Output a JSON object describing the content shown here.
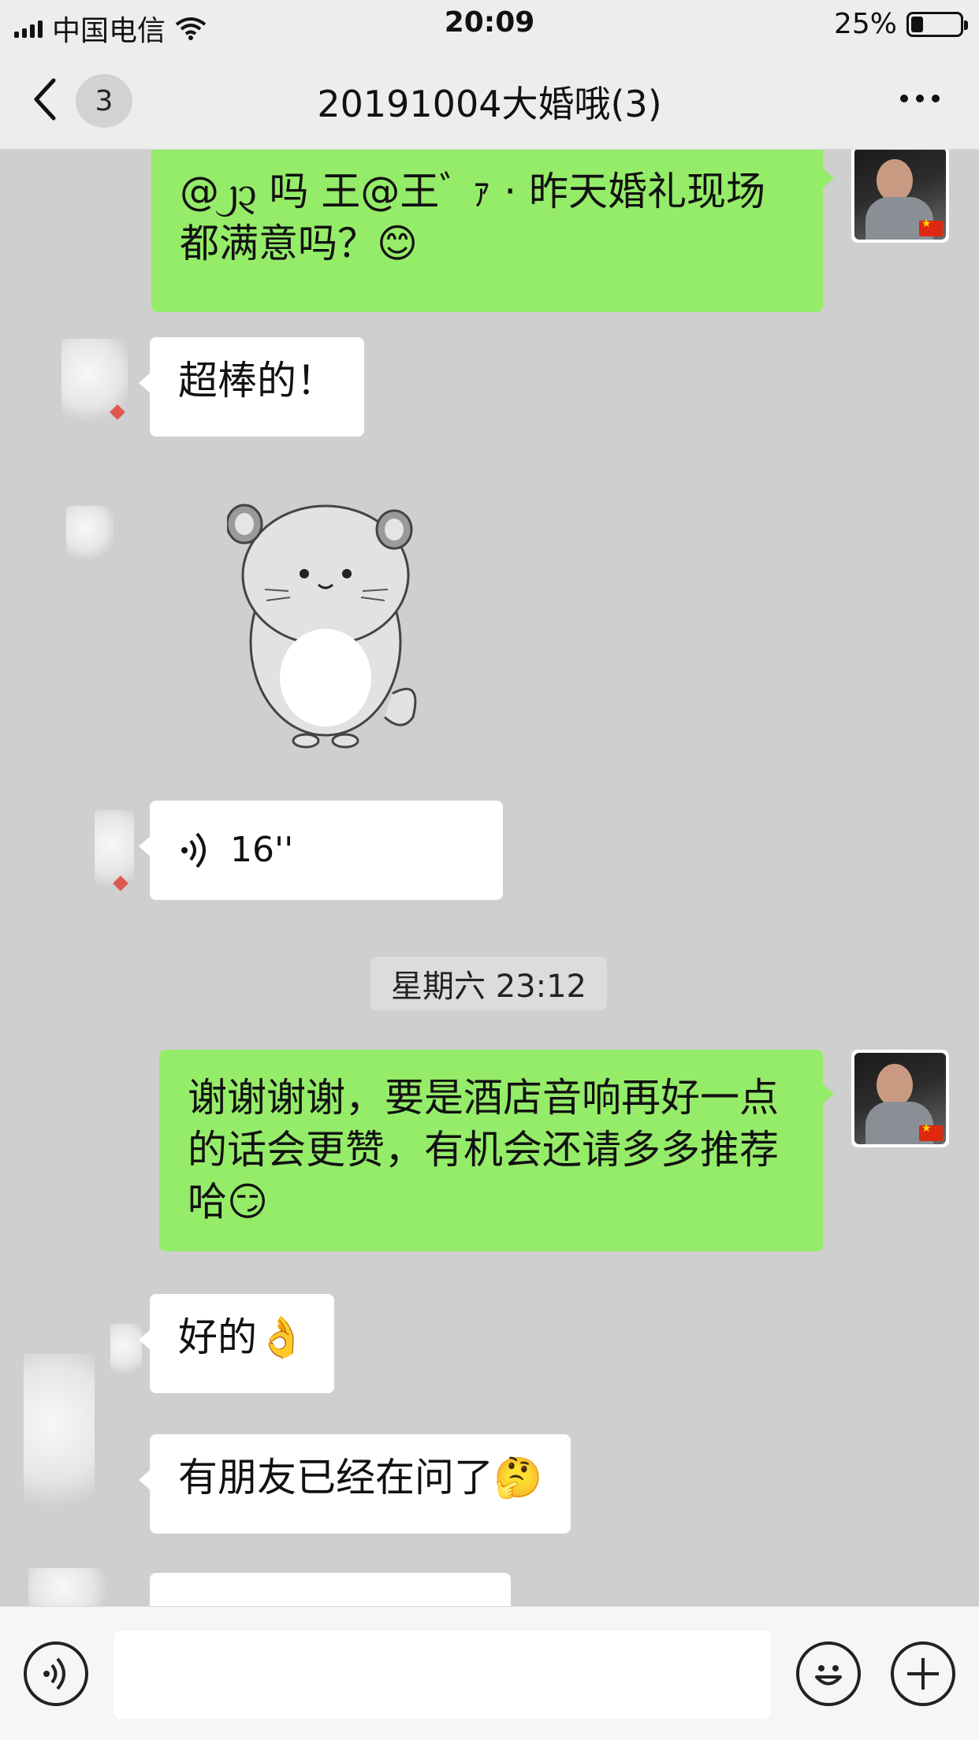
{
  "status_bar": {
    "carrier": "中国电信",
    "time": "20:09",
    "battery_percent": "25%",
    "battery_level": 0.25
  },
  "nav": {
    "title": "20191004大婚哦(3)",
    "unread_badge": "3",
    "back_icon": "chevron-left-icon",
    "more_icon": "more-dots-icon"
  },
  "messages": {
    "m1": "@᧒᧓ 吗 王@王ﾞ ｧ      · 昨天婚礼现场都满意吗？😊",
    "m2": "超棒的！",
    "m3_voice_duration": "16''",
    "timestamp": "星期六 23:12",
    "m4": "谢谢谢谢，要是酒店音响再好一点的话会更赞，有机会还请多多推荐哈😏",
    "m5": "好的👌",
    "m6": "有朋友已经在问了🤔"
  },
  "input_bar": {
    "voice_icon": "voice-icon",
    "emoji_icon": "emoji-icon",
    "plus_icon": "plus-icon"
  },
  "colors": {
    "chat_bg": "#cfcfcf",
    "my_bubble": "#95ec69",
    "other_bubble": "#ffffff",
    "bar_bg": "#ededed"
  }
}
